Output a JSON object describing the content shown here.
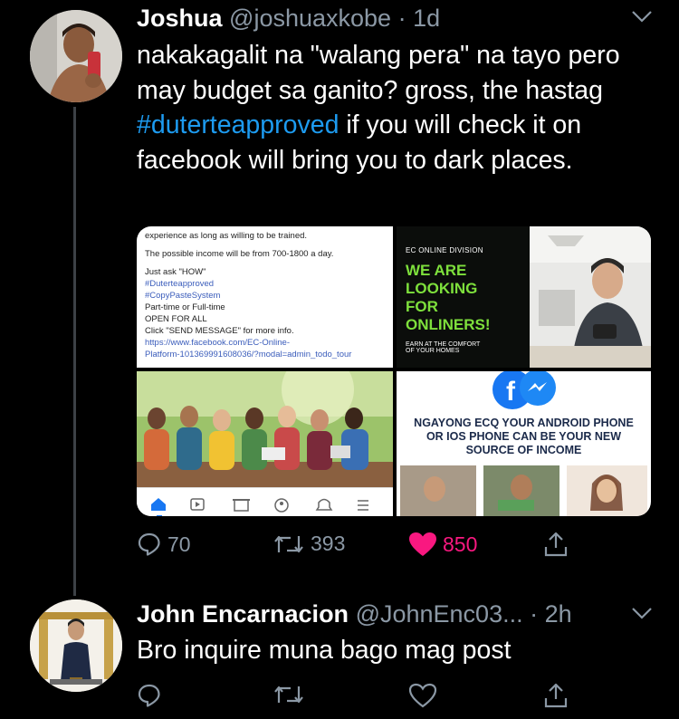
{
  "tweet1": {
    "name": "Joshua",
    "handle": "@joshuaxkobe",
    "time": "1d",
    "text_before": "nakakagalit na \"walang pera\" na tayo pero may budget sa ganito? gross, the hastag ",
    "hashtag": "#duterteapproved",
    "text_after": " if you will check it on facebook will bring you to dark places.",
    "stats": {
      "replies": "70",
      "retweets": "393",
      "likes": "850"
    },
    "media": {
      "post": {
        "line0": "experience as long as willing to be trained.",
        "line1": "The possible income will be from 700-1800 a day.",
        "line2": "Just ask \"HOW\"",
        "line3": "#Duterteapproved",
        "line4": "#CopyPasteSystem",
        "line5": "Part-time or Full-time",
        "line6": "OPEN FOR ALL",
        "line7": "Click \"SEND MESSAGE\" for more info.",
        "line8": "https://www.facebook.com/EC-Online-",
        "line9": "Platform-101369991608036/?modal=admin_todo_tour"
      },
      "ad1": {
        "division": "EC ONLINE DIVISION",
        "headline1": "WE ARE",
        "headline2": "LOOKING",
        "headline3": "FOR",
        "headline4": "ONLINERS!",
        "sub1": "EARN AT THE COMFORT",
        "sub2": "OF YOUR HOMES"
      },
      "ad2": {
        "line1": "NGAYONG ECQ YOUR ANDROID PHONE",
        "line2": "OR IOS PHONE CAN BE YOUR NEW",
        "line3": "SOURCE OF INCOME"
      }
    }
  },
  "tweet2": {
    "name": "John Encarnacion",
    "handle": "@JohnEnc03...",
    "time": "2h",
    "text": "Bro inquire muna bago mag post"
  },
  "colors": {
    "background": "#000000",
    "handle": "#8b98a5",
    "link": "#1d9bf0",
    "like": "#f91880",
    "thread_line": "#3d4146"
  },
  "icons": [
    "reply-icon",
    "retweet-icon",
    "heart-icon",
    "share-icon",
    "chevron-down-icon"
  ]
}
